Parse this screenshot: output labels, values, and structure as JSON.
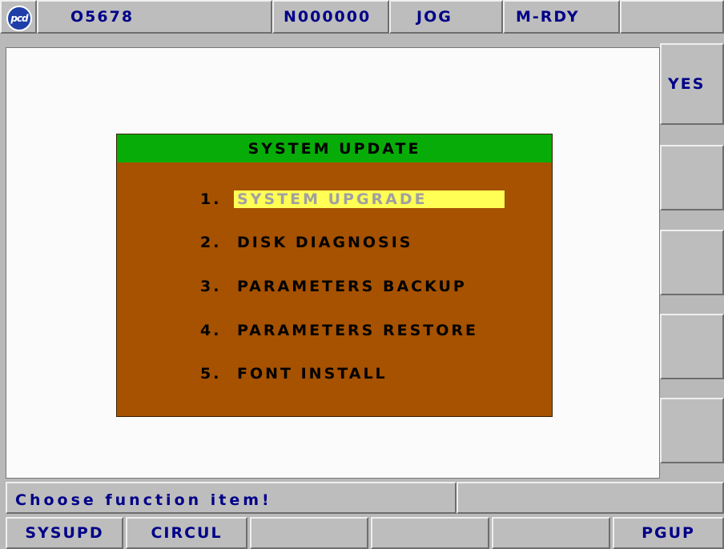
{
  "header": {
    "logo_text": "pcd",
    "program": "O5678",
    "sequence": "N000000",
    "mode": "JOG",
    "status": "M-RDY",
    "extra": ""
  },
  "softkeys_right": [
    "YES",
    "",
    "",
    "",
    ""
  ],
  "dialog": {
    "title": "SYSTEM UPDATE",
    "items": [
      {
        "num": "1.",
        "label": "SYSTEM UPGRADE",
        "selected": true
      },
      {
        "num": "2.",
        "label": "DISK DIAGNOSIS"
      },
      {
        "num": "3.",
        "label": "PARAMETERS BACKUP"
      },
      {
        "num": "4.",
        "label": "PARAMETERS RESTORE"
      },
      {
        "num": "5.",
        "label": "FONT INSTALL"
      }
    ]
  },
  "message": "Choose function item!",
  "softkeys_bottom": [
    "SYSUPD",
    "CIRCUL",
    "",
    "",
    "",
    "PGUP"
  ]
}
